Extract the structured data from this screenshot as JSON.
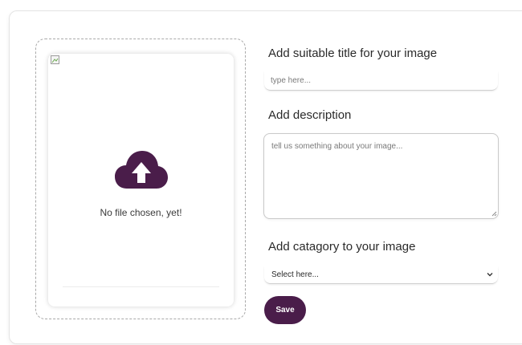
{
  "upload": {
    "status_text": "No file chosen, yet!",
    "icon": "cloud-upload-icon",
    "broken_image_icon": "broken-image-icon",
    "icon_color": "#4a1d4a"
  },
  "form": {
    "title_label": "Add suitable title for your image",
    "title_placeholder": "type here...",
    "title_value": "",
    "description_label": "Add description",
    "description_placeholder": "tell us something about your image...",
    "description_value": "",
    "category_label": "Add catagory to your image",
    "category_selected": "Select here...",
    "save_label": "Save"
  },
  "colors": {
    "accent": "#4a1d4a",
    "border": "#c9c9c9"
  }
}
